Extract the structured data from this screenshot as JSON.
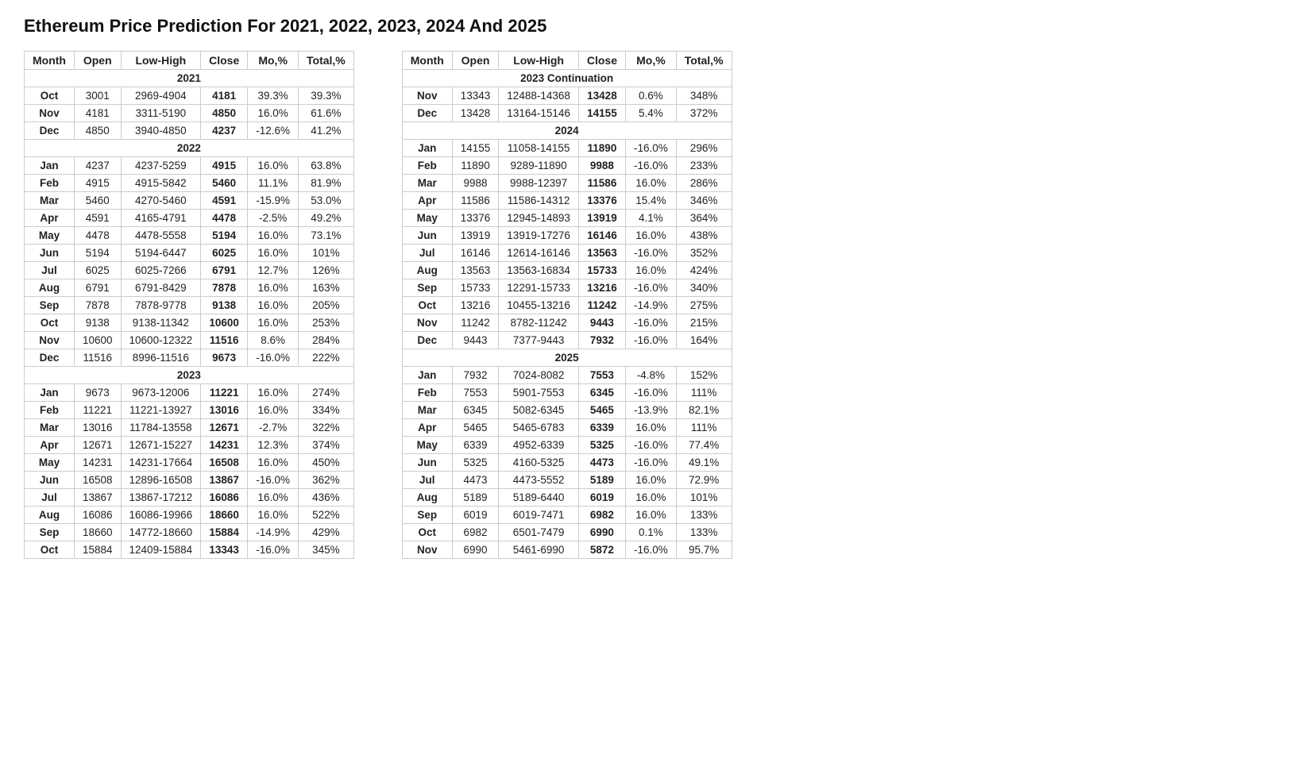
{
  "title": "Ethereum Price Prediction For 2021, 2022, 2023, 2024 And 2025",
  "table1": {
    "headers": [
      "Month",
      "Open",
      "Low-High",
      "Close",
      "Mo,%",
      "Total,%"
    ],
    "sections": [
      {
        "year": "2021",
        "rows": [
          [
            "Oct",
            "3001",
            "2969-4904",
            "4181",
            "39.3%",
            "39.3%"
          ],
          [
            "Nov",
            "4181",
            "3311-5190",
            "4850",
            "16.0%",
            "61.6%"
          ],
          [
            "Dec",
            "4850",
            "3940-4850",
            "4237",
            "-12.6%",
            "41.2%"
          ]
        ]
      },
      {
        "year": "2022",
        "rows": [
          [
            "Jan",
            "4237",
            "4237-5259",
            "4915",
            "16.0%",
            "63.8%"
          ],
          [
            "Feb",
            "4915",
            "4915-5842",
            "5460",
            "11.1%",
            "81.9%"
          ],
          [
            "Mar",
            "5460",
            "4270-5460",
            "4591",
            "-15.9%",
            "53.0%"
          ],
          [
            "Apr",
            "4591",
            "4165-4791",
            "4478",
            "-2.5%",
            "49.2%"
          ],
          [
            "May",
            "4478",
            "4478-5558",
            "5194",
            "16.0%",
            "73.1%"
          ],
          [
            "Jun",
            "5194",
            "5194-6447",
            "6025",
            "16.0%",
            "101%"
          ],
          [
            "Jul",
            "6025",
            "6025-7266",
            "6791",
            "12.7%",
            "126%"
          ],
          [
            "Aug",
            "6791",
            "6791-8429",
            "7878",
            "16.0%",
            "163%"
          ],
          [
            "Sep",
            "7878",
            "7878-9778",
            "9138",
            "16.0%",
            "205%"
          ],
          [
            "Oct",
            "9138",
            "9138-11342",
            "10600",
            "16.0%",
            "253%"
          ],
          [
            "Nov",
            "10600",
            "10600-12322",
            "11516",
            "8.6%",
            "284%"
          ],
          [
            "Dec",
            "11516",
            "8996-11516",
            "9673",
            "-16.0%",
            "222%"
          ]
        ]
      },
      {
        "year": "2023",
        "rows": [
          [
            "Jan",
            "9673",
            "9673-12006",
            "11221",
            "16.0%",
            "274%"
          ],
          [
            "Feb",
            "11221",
            "11221-13927",
            "13016",
            "16.0%",
            "334%"
          ],
          [
            "Mar",
            "13016",
            "11784-13558",
            "12671",
            "-2.7%",
            "322%"
          ],
          [
            "Apr",
            "12671",
            "12671-15227",
            "14231",
            "12.3%",
            "374%"
          ],
          [
            "May",
            "14231",
            "14231-17664",
            "16508",
            "16.0%",
            "450%"
          ],
          [
            "Jun",
            "16508",
            "12896-16508",
            "13867",
            "-16.0%",
            "362%"
          ],
          [
            "Jul",
            "13867",
            "13867-17212",
            "16086",
            "16.0%",
            "436%"
          ],
          [
            "Aug",
            "16086",
            "16086-19966",
            "18660",
            "16.0%",
            "522%"
          ],
          [
            "Sep",
            "18660",
            "14772-18660",
            "15884",
            "-14.9%",
            "429%"
          ],
          [
            "Oct",
            "15884",
            "12409-15884",
            "13343",
            "-16.0%",
            "345%"
          ]
        ]
      }
    ]
  },
  "table2": {
    "headers": [
      "Month",
      "Open",
      "Low-High",
      "Close",
      "Mo,%",
      "Total,%"
    ],
    "sections": [
      {
        "year": "2023 Continuation",
        "rows": [
          [
            "Nov",
            "13343",
            "12488-14368",
            "13428",
            "0.6%",
            "348%"
          ],
          [
            "Dec",
            "13428",
            "13164-15146",
            "14155",
            "5.4%",
            "372%"
          ]
        ]
      },
      {
        "year": "2024",
        "rows": [
          [
            "Jan",
            "14155",
            "11058-14155",
            "11890",
            "-16.0%",
            "296%"
          ],
          [
            "Feb",
            "11890",
            "9289-11890",
            "9988",
            "-16.0%",
            "233%"
          ],
          [
            "Mar",
            "9988",
            "9988-12397",
            "11586",
            "16.0%",
            "286%"
          ],
          [
            "Apr",
            "11586",
            "11586-14312",
            "13376",
            "15.4%",
            "346%"
          ],
          [
            "May",
            "13376",
            "12945-14893",
            "13919",
            "4.1%",
            "364%"
          ],
          [
            "Jun",
            "13919",
            "13919-17276",
            "16146",
            "16.0%",
            "438%"
          ],
          [
            "Jul",
            "16146",
            "12614-16146",
            "13563",
            "-16.0%",
            "352%"
          ],
          [
            "Aug",
            "13563",
            "13563-16834",
            "15733",
            "16.0%",
            "424%"
          ],
          [
            "Sep",
            "15733",
            "12291-15733",
            "13216",
            "-16.0%",
            "340%"
          ],
          [
            "Oct",
            "13216",
            "10455-13216",
            "11242",
            "-14.9%",
            "275%"
          ],
          [
            "Nov",
            "11242",
            "8782-11242",
            "9443",
            "-16.0%",
            "215%"
          ],
          [
            "Dec",
            "9443",
            "7377-9443",
            "7932",
            "-16.0%",
            "164%"
          ]
        ]
      },
      {
        "year": "2025",
        "rows": [
          [
            "Jan",
            "7932",
            "7024-8082",
            "7553",
            "-4.8%",
            "152%"
          ],
          [
            "Feb",
            "7553",
            "5901-7553",
            "6345",
            "-16.0%",
            "111%"
          ],
          [
            "Mar",
            "6345",
            "5082-6345",
            "5465",
            "-13.9%",
            "82.1%"
          ],
          [
            "Apr",
            "5465",
            "5465-6783",
            "6339",
            "16.0%",
            "111%"
          ],
          [
            "May",
            "6339",
            "4952-6339",
            "5325",
            "-16.0%",
            "77.4%"
          ],
          [
            "Jun",
            "5325",
            "4160-5325",
            "4473",
            "-16.0%",
            "49.1%"
          ],
          [
            "Jul",
            "4473",
            "4473-5552",
            "5189",
            "16.0%",
            "72.9%"
          ],
          [
            "Aug",
            "5189",
            "5189-6440",
            "6019",
            "16.0%",
            "101%"
          ],
          [
            "Sep",
            "6019",
            "6019-7471",
            "6982",
            "16.0%",
            "133%"
          ],
          [
            "Oct",
            "6982",
            "6501-7479",
            "6990",
            "0.1%",
            "133%"
          ],
          [
            "Nov",
            "6990",
            "5461-6990",
            "5872",
            "-16.0%",
            "95.7%"
          ]
        ]
      }
    ]
  }
}
